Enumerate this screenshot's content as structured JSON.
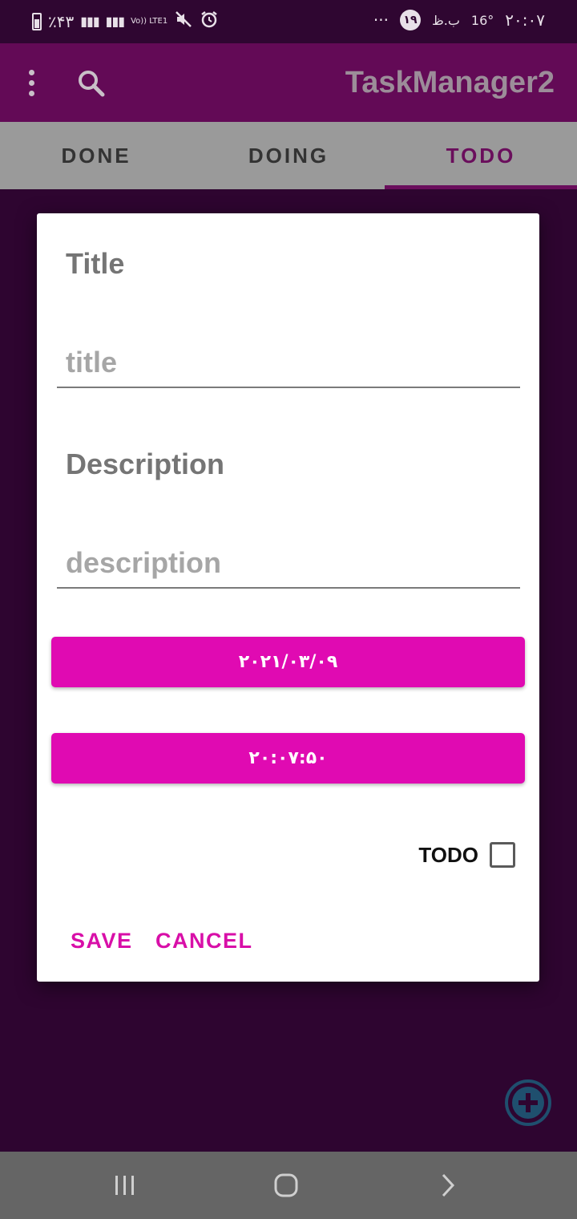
{
  "status_bar": {
    "battery_percent": "٪۴۳",
    "volte": "Vo)) LTE1",
    "dots": "···",
    "notif_badge": "۱۹",
    "temp": "16°",
    "pm": "ب.ظ",
    "time": "۲۰:۰۷"
  },
  "app_bar": {
    "title": "TaskManager2"
  },
  "tabs": [
    {
      "label": "DONE"
    },
    {
      "label": "DOING"
    },
    {
      "label": "TODO"
    }
  ],
  "dialog": {
    "title_label": "Title",
    "title_placeholder": "title",
    "description_label": "Description",
    "description_placeholder": "description",
    "date_button": "۲۰۲۱/۰۳/۰۹",
    "time_button": "۲۰:۰۷:۵۰",
    "status_label": "TODO",
    "save": "SAVE",
    "cancel": "CANCEL"
  },
  "colors": {
    "app_bar": "#630a56",
    "accent": "#e00ab2",
    "background": "#2e0530",
    "tab_bar": "#9a9a9a"
  }
}
